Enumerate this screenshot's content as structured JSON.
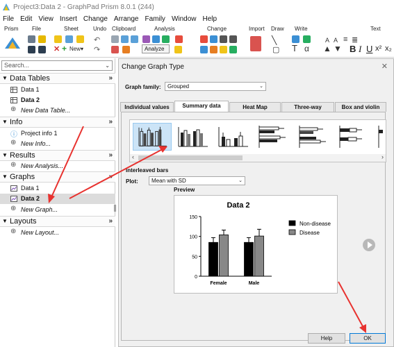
{
  "window": {
    "title": "Project3:Data 2 - GraphPad Prism 8.0.1 (244)"
  },
  "menu": [
    "File",
    "Edit",
    "View",
    "Insert",
    "Change",
    "Arrange",
    "Family",
    "Window",
    "Help"
  ],
  "ribbon": {
    "groups": [
      "Prism",
      "File",
      "Sheet",
      "Undo",
      "Clipboard",
      "Analysis",
      "Change",
      "Import",
      "Draw",
      "Write",
      "Text"
    ],
    "new_label": "New",
    "analyze_label": "Analyze",
    "text_tools": [
      "B",
      "I",
      "U",
      "x²",
      "x₂"
    ]
  },
  "sidebar": {
    "search_placeholder": "Search...",
    "sections": [
      {
        "title": "Data Tables",
        "items": [
          "Data 1",
          "Data 2",
          "New Data Table..."
        ]
      },
      {
        "title": "Info",
        "items": [
          "Project info 1",
          "New Info..."
        ]
      },
      {
        "title": "Results",
        "items": [
          "New Analysis..."
        ]
      },
      {
        "title": "Graphs",
        "items": [
          "Data 1",
          "Data 2",
          "New Graph..."
        ]
      },
      {
        "title": "Layouts",
        "items": [
          "New Layout..."
        ]
      }
    ]
  },
  "dialog": {
    "title": "Change Graph Type",
    "graph_family_label": "Graph family:",
    "graph_family_value": "Grouped",
    "tabs": [
      "Individual values",
      "Summary data",
      "Heat Map",
      "Three-way",
      "Box and violin"
    ],
    "active_tab": "Summary data",
    "selected_type_label": "Interleaved bars",
    "plot_label": "Plot:",
    "plot_value": "Mean with SD",
    "preview_label": "Preview",
    "help_button": "Help",
    "ok_button": "OK"
  },
  "chart_data": {
    "type": "bar",
    "title": "Data 2",
    "categories": [
      "Female",
      "Male"
    ],
    "series": [
      {
        "name": "Non-disease",
        "values": [
          85,
          85
        ],
        "errors": [
          12,
          12
        ],
        "color": "#000000"
      },
      {
        "name": "Disease",
        "values": [
          104,
          101
        ],
        "errors": [
          12,
          17
        ],
        "color": "#888888"
      }
    ],
    "ylim": [
      0,
      150
    ],
    "yticks": [
      "0",
      "50",
      "100",
      "150"
    ],
    "legend": "right"
  },
  "colors": {
    "annotation_arrow": "#e8322f",
    "selection": "#cce4f7"
  }
}
